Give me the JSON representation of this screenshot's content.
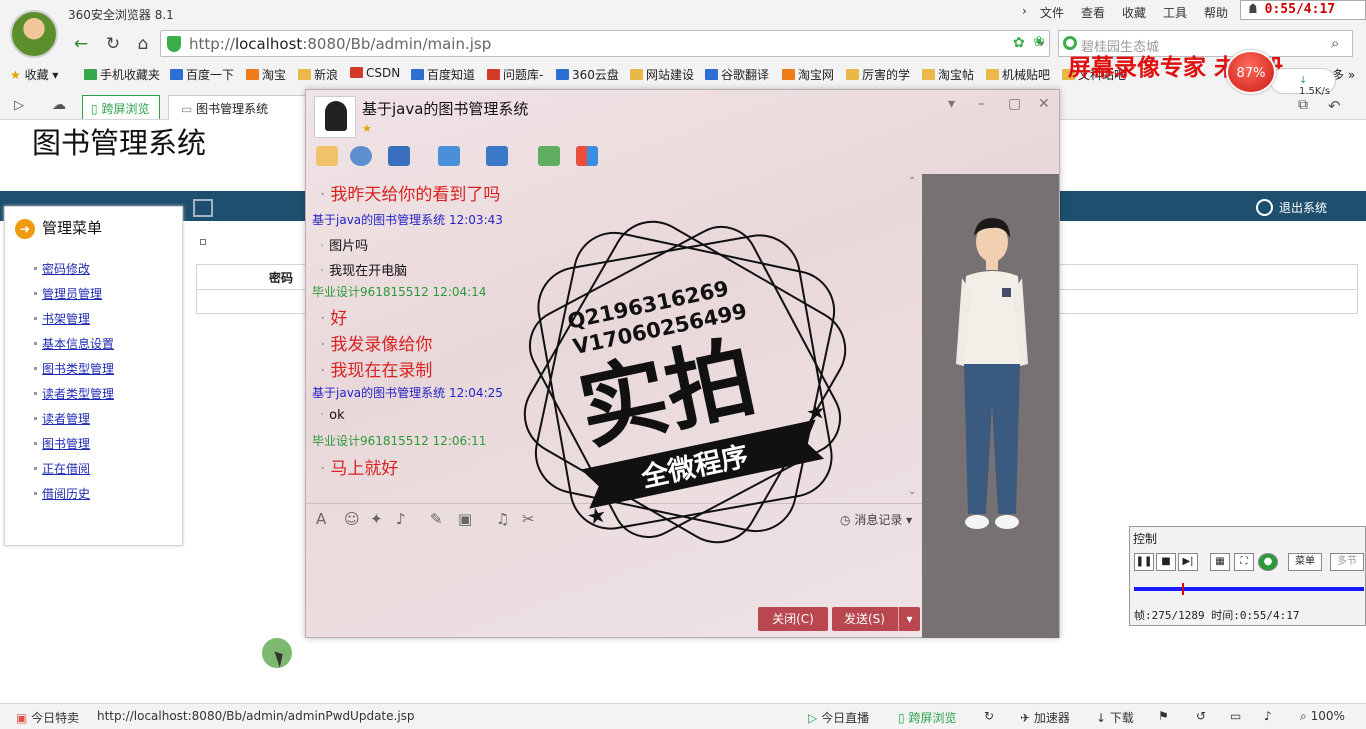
{
  "browser": {
    "title": "360安全浏览器 8.1",
    "menu": [
      "文件",
      "查看",
      "收藏",
      "工具",
      "帮助"
    ],
    "address_prefix": "http://",
    "address_host": "localhost",
    "address_rest": ":8080/Bb/admin/main.jsp",
    "search_placeholder": "碧桂园生态城",
    "bookmarks": [
      "收藏",
      "手机收藏夹",
      "百度一下",
      "淘宝",
      "新浪",
      "CSDN",
      "百度知道",
      "问题库-",
      "360云盘",
      "网站建设",
      "谷歌翻译",
      "淘宝网",
      "厉害的学",
      "淘宝帖",
      "机械贴吧",
      "文科站吧"
    ],
    "tabs": [
      "跨屏浏览",
      "图书管理系统"
    ],
    "speed_percent": "87%",
    "speed_rate": "1.5K/s",
    "more": "多"
  },
  "recorder": {
    "timer": "0:55/4:17",
    "watermark": "屏幕录像专家 未注册",
    "control_title": "控制",
    "menu_label": "菜单",
    "more_label": "多节",
    "info": "帧:275/1289 时间:0:55/4:17",
    "progress": 0.21
  },
  "page": {
    "title": "图书管理系统",
    "logout": "退出系统",
    "sidebar_title": "管理菜单",
    "sidebar_items": [
      "密码修改",
      "管理员管理",
      "书架管理",
      "基本信息设置",
      "图书类型管理",
      "读者类型管理",
      "读者管理",
      "图书管理",
      "正在借阅",
      "借阅历史"
    ],
    "grid_header": "密码"
  },
  "chat": {
    "title": "基于java的图书管理系统",
    "history_label": "消息记录",
    "close_label": "关闭(C)",
    "send_label": "发送(S)",
    "messages": [
      {
        "type": "red",
        "text": "我昨天给你的看到了吗"
      },
      {
        "type": "sender-blue",
        "text": "基于java的图书管理系统",
        "time": "12:03:43"
      },
      {
        "type": "black",
        "text": "图片吗"
      },
      {
        "type": "black",
        "text": "我现在开电脑"
      },
      {
        "type": "sender-green",
        "text": "毕业设计961815512",
        "time": "12:04:14"
      },
      {
        "type": "red",
        "text": "好"
      },
      {
        "type": "red",
        "text": "我发录像给你"
      },
      {
        "type": "red",
        "text": "我现在在录制"
      },
      {
        "type": "sender-blue",
        "text": "基于java的图书管理系统",
        "time": "12:04:25"
      },
      {
        "type": "black",
        "text": "ok"
      },
      {
        "type": "sender-green",
        "text": "毕业设计961815512",
        "time": "12:06:11"
      },
      {
        "type": "red",
        "text": "马上就好"
      }
    ]
  },
  "stamp": {
    "line1": "Q2196316269",
    "line2": "V17060256499",
    "big": "实拍",
    "ribbon": "全微程序"
  },
  "status": {
    "today_deals": "今日特卖",
    "url": "http://localhost:8080/Bb/admin/adminPwdUpdate.jsp",
    "live": "今日直播",
    "split": "跨屏浏览",
    "accelerator": "加速器",
    "download": "下载",
    "zoom": "100%"
  }
}
